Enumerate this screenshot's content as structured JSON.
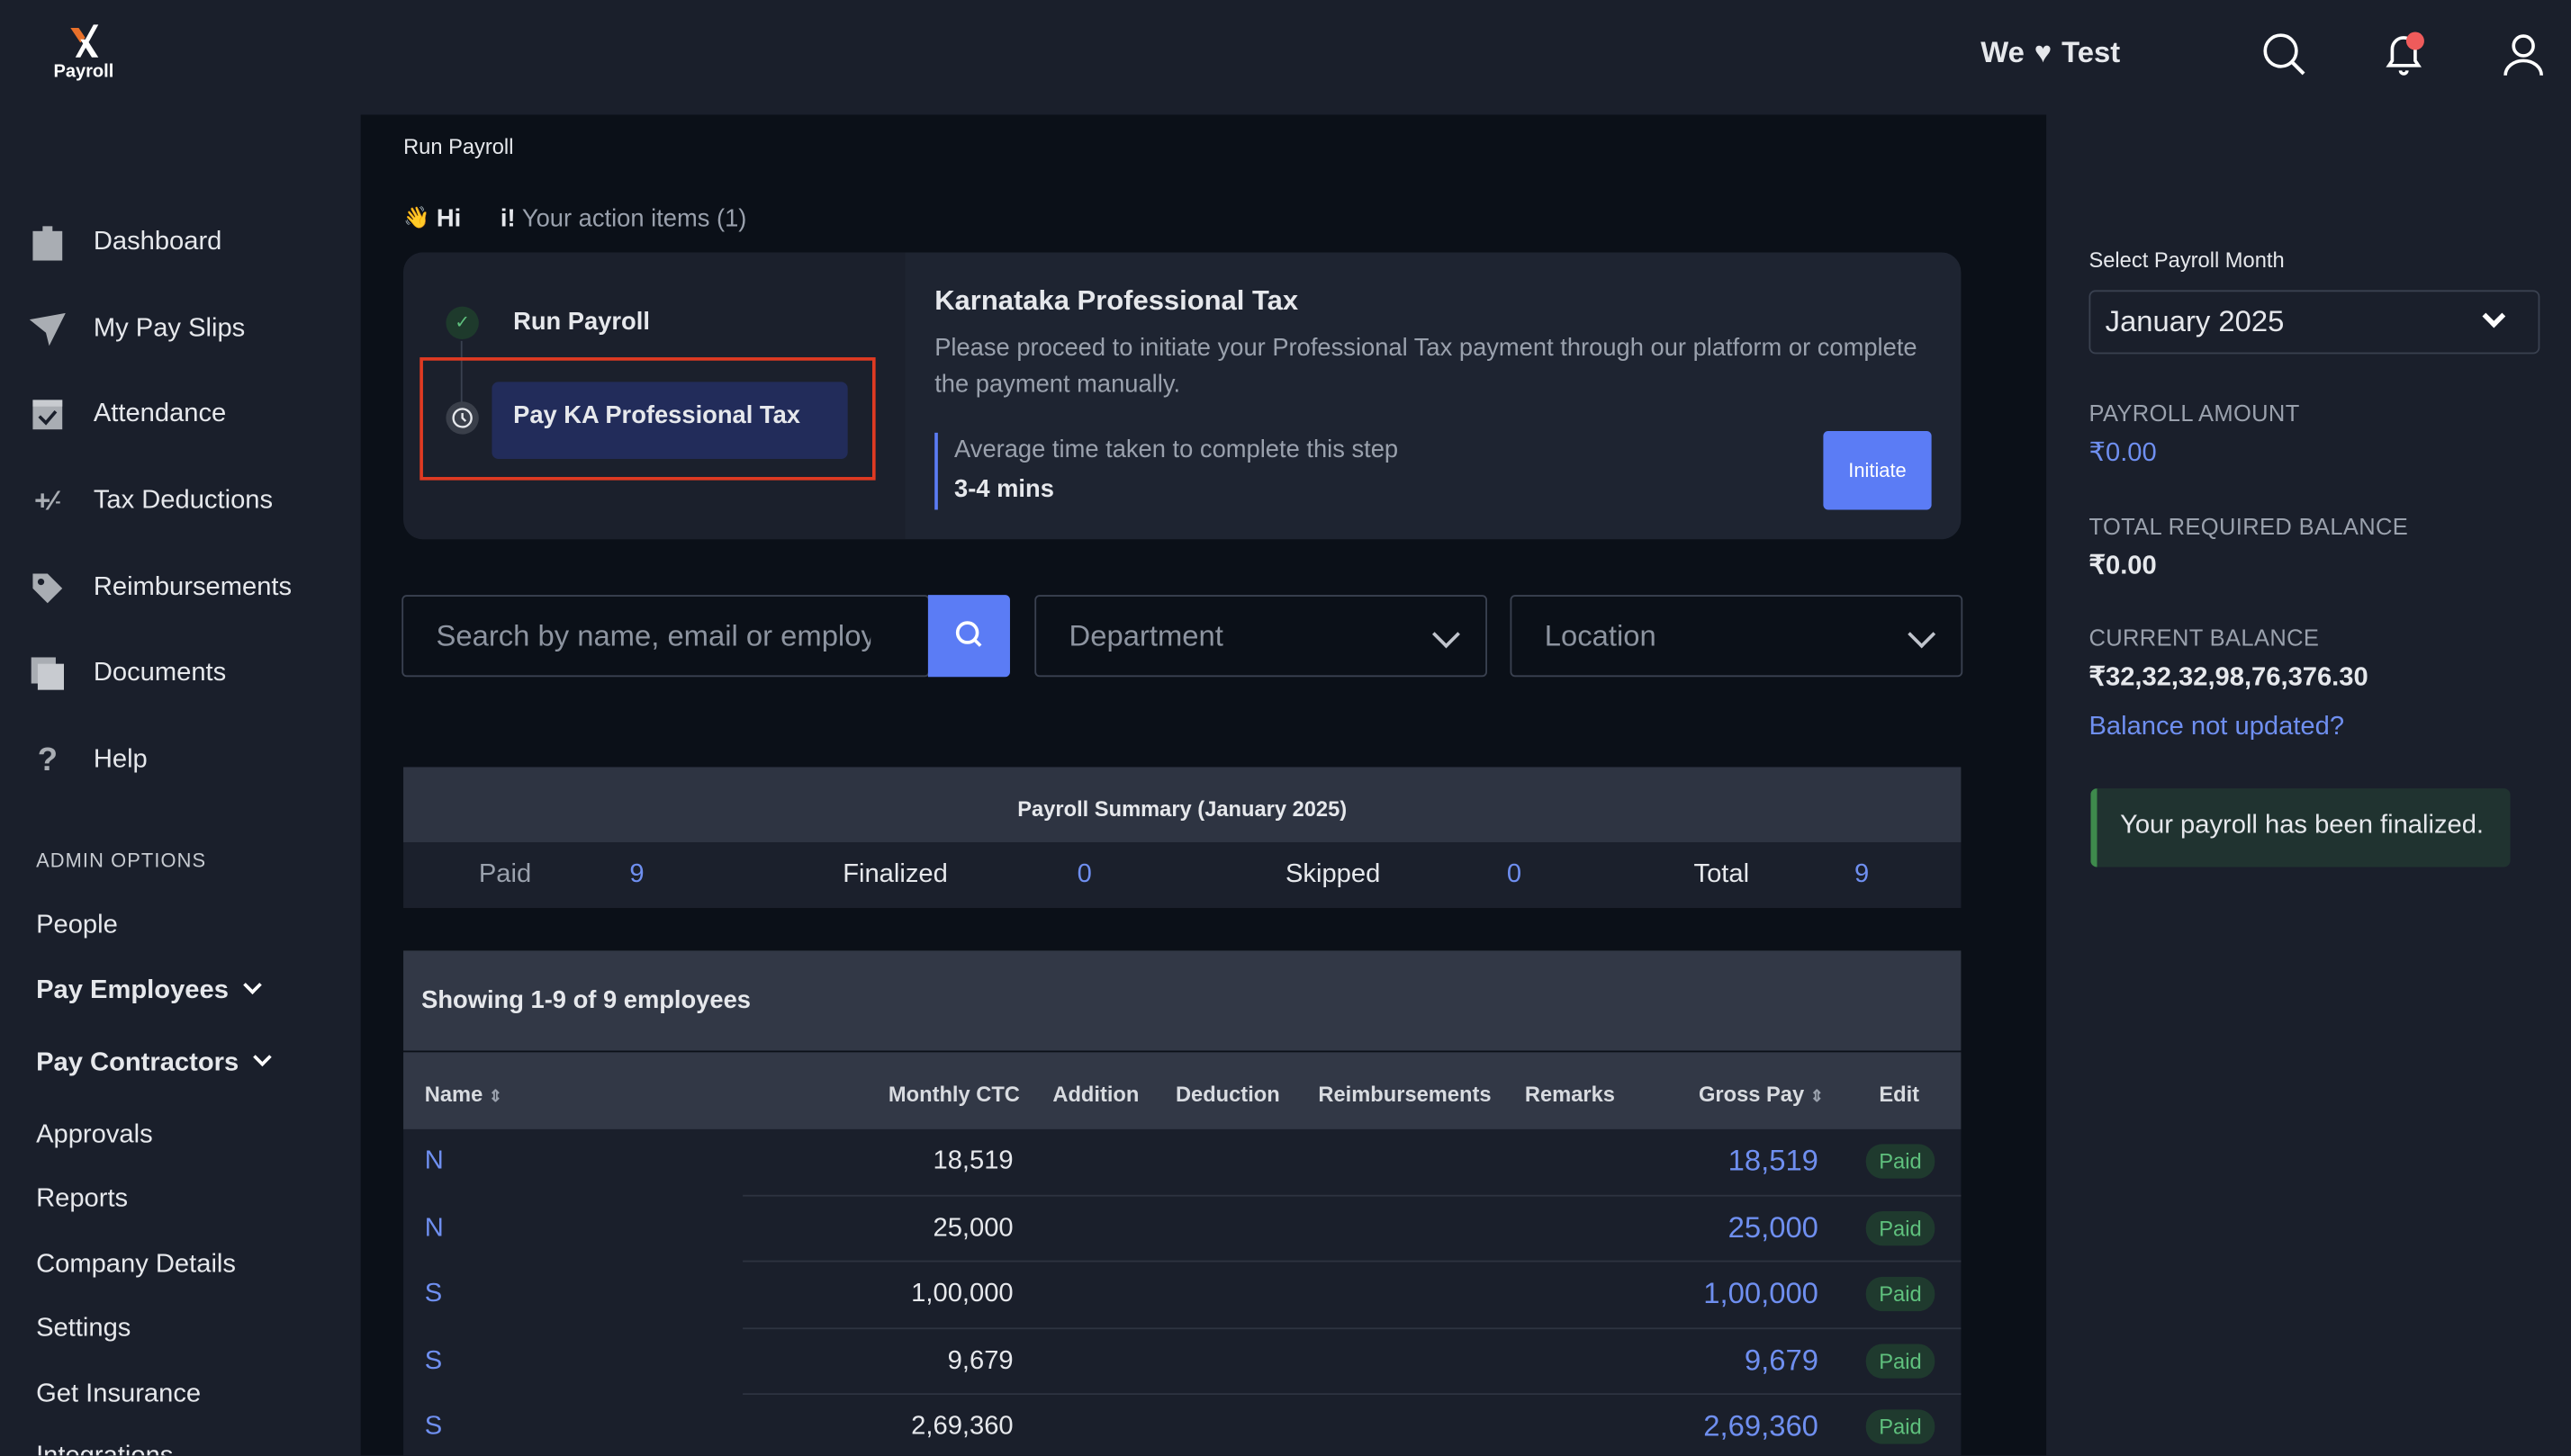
{
  "brand": {
    "logo_text": "Payroll",
    "accent": "#e8702a"
  },
  "header": {
    "org_name": "We",
    "org_suffix": "Test",
    "heart": "♥",
    "icons": [
      "search-icon",
      "bell-icon",
      "user-icon"
    ]
  },
  "sidebar": {
    "items": [
      {
        "label": "Dashboard",
        "icon": "clipboard-icon"
      },
      {
        "label": "My Pay Slips",
        "icon": "send-icon"
      },
      {
        "label": "Attendance",
        "icon": "calendar-check-icon"
      },
      {
        "label": "Tax Deductions",
        "icon": "percent-icon"
      },
      {
        "label": "Reimbursements",
        "icon": "tag-icon"
      },
      {
        "label": "Documents",
        "icon": "documents-icon"
      },
      {
        "label": "Help",
        "icon": "question-icon"
      }
    ],
    "admin_heading": "ADMIN OPTIONS",
    "admin_items": [
      {
        "label": "People"
      },
      {
        "label": "Pay Employees"
      },
      {
        "label": "Pay Contractors"
      },
      {
        "label": "Approvals"
      },
      {
        "label": "Reports"
      },
      {
        "label": "Company Details"
      },
      {
        "label": "Settings"
      },
      {
        "label": "Get Insurance"
      },
      {
        "label": "Integrations"
      }
    ]
  },
  "main": {
    "breadcrumb": "Run Payroll",
    "greeting": "Hi",
    "greeting_emoji": "👋",
    "action_prefix": "i!",
    "action_items": "Your action items (1)",
    "steps": [
      {
        "label": "Run Payroll",
        "status": "done"
      },
      {
        "label": "Pay KA Professional Tax",
        "status": "pending"
      }
    ],
    "task": {
      "title": "Karnataka Professional Tax",
      "description": "Please proceed to initiate your Professional Tax payment through our platform or complete the payment manually.",
      "time_label": "Average time taken to complete this step",
      "time_value": "3-4 mins",
      "button": "Initiate"
    },
    "filters": {
      "search_placeholder": "Search by name, email or employee ID",
      "department": "Department",
      "location": "Location"
    },
    "summary": {
      "title": "Payroll Summary (January 2025)",
      "stats": [
        {
          "label": "Paid",
          "value": "9"
        },
        {
          "label": "Finalized",
          "value": "0"
        },
        {
          "label": "Skipped",
          "value": "0"
        },
        {
          "label": "Total",
          "value": "9"
        }
      ]
    },
    "table": {
      "showing": "Showing 1-9 of 9 employees",
      "columns": [
        "Name",
        "Monthly CTC",
        "Addition",
        "Deduction",
        "Reimbursements",
        "Remarks",
        "Gross Pay",
        "Edit"
      ],
      "rows": [
        {
          "name": "N",
          "ctc": "18,519",
          "gross": "18,519",
          "status": "Paid"
        },
        {
          "name": "N",
          "ctc": "25,000",
          "gross": "25,000",
          "status": "Paid"
        },
        {
          "name": "S",
          "ctc": "1,00,000",
          "gross": "1,00,000",
          "status": "Paid"
        },
        {
          "name": "S",
          "ctc": "9,679",
          "gross": "9,679",
          "status": "Paid"
        },
        {
          "name": "S",
          "ctc": "2,69,360",
          "gross": "2,69,360",
          "status": "Paid"
        }
      ]
    }
  },
  "right": {
    "month_label": "Select Payroll Month",
    "month": "January 2025",
    "payroll_amount_label": "PAYROLL AMOUNT",
    "payroll_amount": "₹0.00",
    "required_label": "TOTAL REQUIRED BALANCE",
    "required": "₹0.00",
    "balance_label": "CURRENT BALANCE",
    "balance": "₹32,32,32,98,76,376.30",
    "balance_link": "Balance not updated?",
    "finalized": "Your payroll has been finalized."
  }
}
